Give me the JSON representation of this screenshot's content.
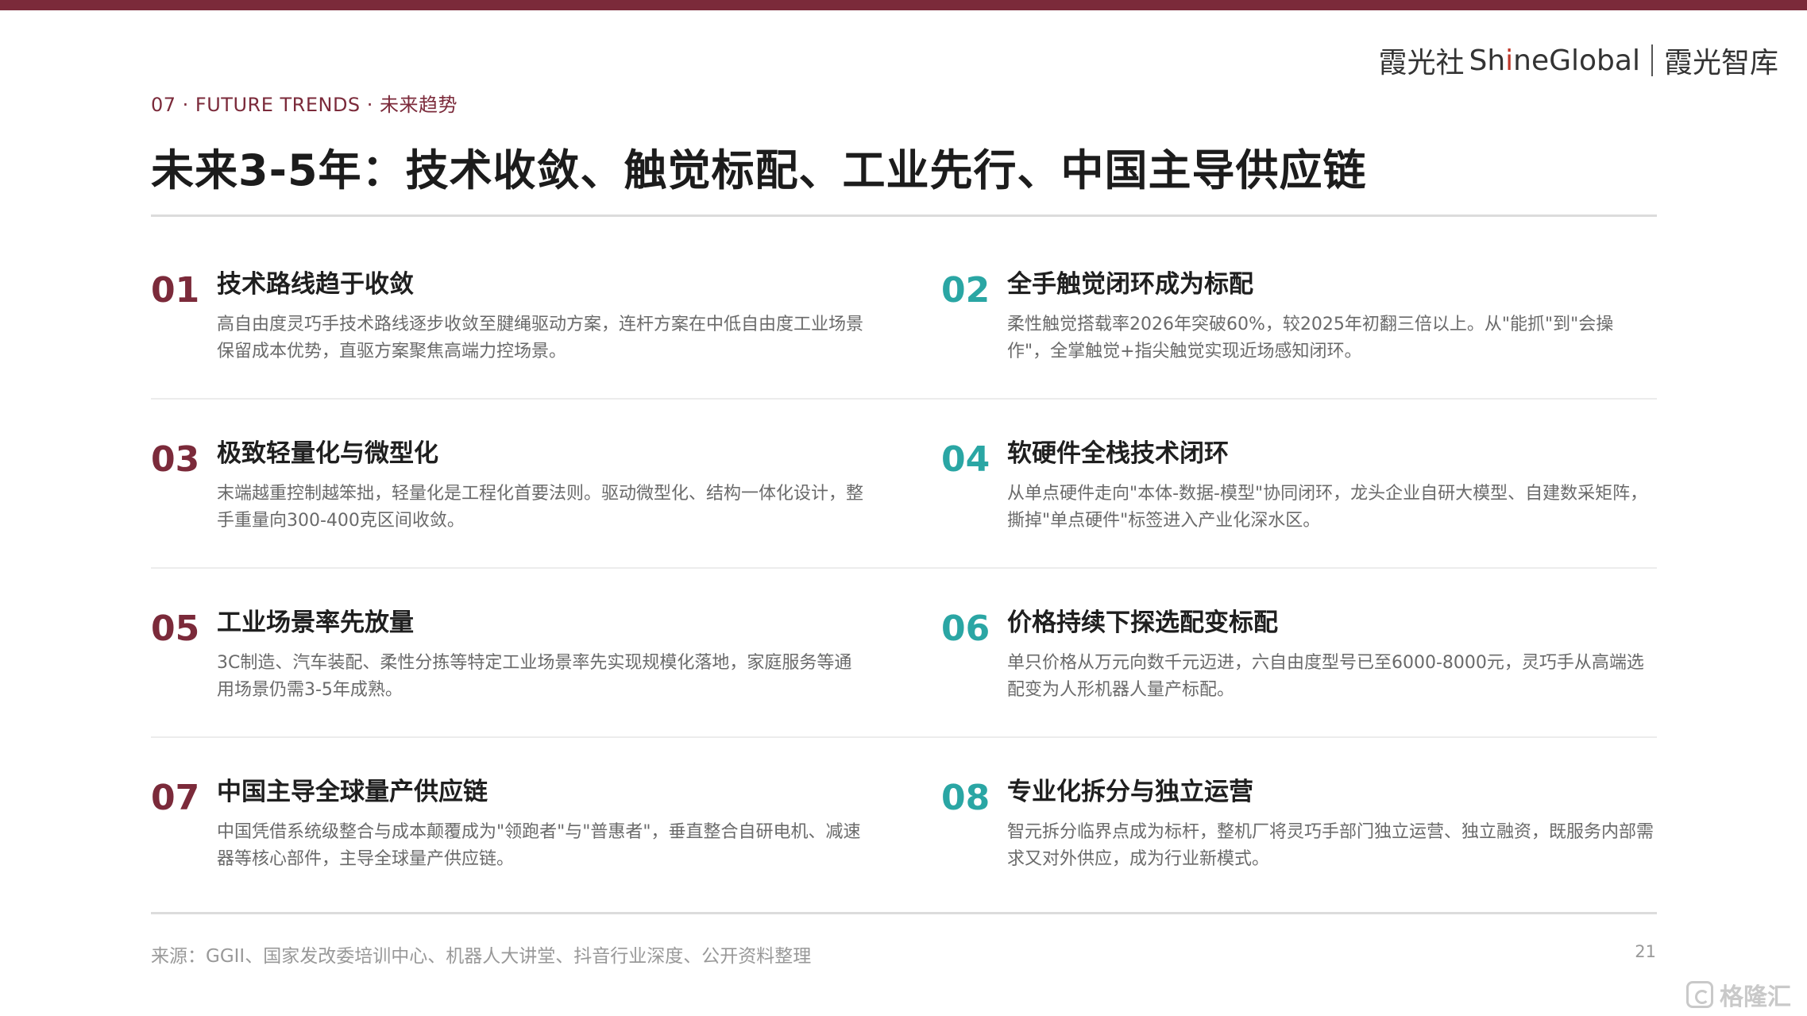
{
  "colors": {
    "accent": "#7b2a3a",
    "teal": "#2aa6a4"
  },
  "brand": {
    "left": "霞光社",
    "shine_prefix": "Sh",
    "shine_i": "i",
    "shine_suffix": "neGlobal",
    "right": "霞光智库"
  },
  "section_label": "07 · FUTURE TRENDS · 未来趋势",
  "title": "未来3-5年：技术收敛、触觉标配、工业先行、中国主导供应链",
  "items": [
    {
      "num": "01",
      "title": "技术路线趋于收敛",
      "desc": "高自由度灵巧手技术路线逐步收敛至腱绳驱动方案，连杆方案在中低自由度工业场景保留成本优势，直驱方案聚焦高端力控场景。"
    },
    {
      "num": "02",
      "title": "全手触觉闭环成为标配",
      "desc": "柔性触觉搭载率2026年突破60%，较2025年初翻三倍以上。从\"能抓\"到\"会操作\"，全掌触觉+指尖触觉实现近场感知闭环。"
    },
    {
      "num": "03",
      "title": "极致轻量化与微型化",
      "desc": "末端越重控制越笨拙，轻量化是工程化首要法则。驱动微型化、结构一体化设计，整手重量向300-400克区间收敛。"
    },
    {
      "num": "04",
      "title": "软硬件全栈技术闭环",
      "desc": "从单点硬件走向\"本体-数据-模型\"协同闭环，龙头企业自研大模型、自建数采矩阵，撕掉\"单点硬件\"标签进入产业化深水区。"
    },
    {
      "num": "05",
      "title": "工业场景率先放量",
      "desc": "3C制造、汽车装配、柔性分拣等特定工业场景率先实现规模化落地，家庭服务等通用场景仍需3-5年成熟。"
    },
    {
      "num": "06",
      "title": "价格持续下探选配变标配",
      "desc": "单只价格从万元向数千元迈进，六自由度型号已至6000-8000元，灵巧手从高端选配变为人形机器人量产标配。"
    },
    {
      "num": "07",
      "title": "中国主导全球量产供应链",
      "desc": "中国凭借系统级整合与成本颠覆成为\"领跑者\"与\"普惠者\"，垂直整合自研电机、减速器等核心部件，主导全球量产供应链。"
    },
    {
      "num": "08",
      "title": "专业化拆分与独立运营",
      "desc": "智元拆分临界点成为标杆，整机厂将灵巧手部门独立运营、独立融资，既服务内部需求又对外供应，成为行业新模式。"
    }
  ],
  "source": "来源：GGII、国家发改委培训中心、机器人大讲堂、抖音行业深度、公开资料整理",
  "page_number": "21",
  "watermark": "格隆汇"
}
